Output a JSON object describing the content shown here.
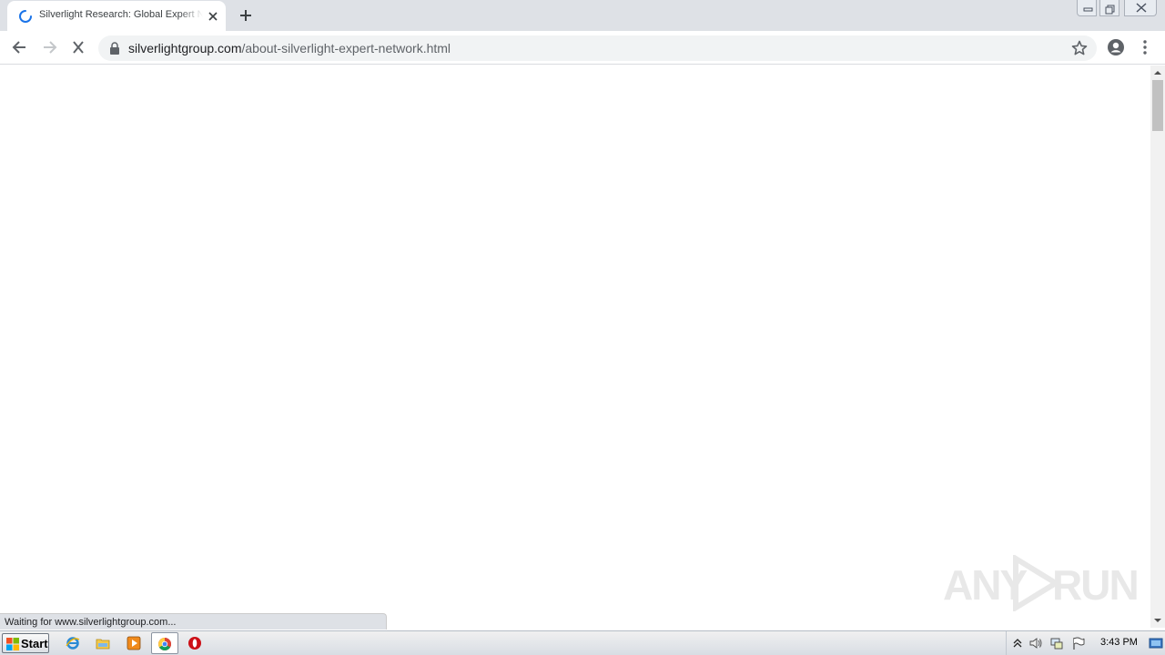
{
  "browser": {
    "tab": {
      "title": "Silverlight Research: Global Expert Network",
      "loading": true
    },
    "address_bar": {
      "host": "silverlightgroup.com",
      "path": "/about-silverlight-expert-network.html",
      "secure": true
    },
    "status_text": "Waiting for www.silverlightgroup.com...",
    "accent_color": "#1a73e8"
  },
  "watermark": {
    "text_left": "ANY",
    "text_right": "RUN"
  },
  "taskbar": {
    "start_label": "Start",
    "pinned_apps": [
      "internet-explorer-icon",
      "file-explorer-icon",
      "media-player-icon",
      "chrome-icon",
      "opera-icon"
    ],
    "active_app": "chrome-icon",
    "clock": "3:43 PM"
  }
}
